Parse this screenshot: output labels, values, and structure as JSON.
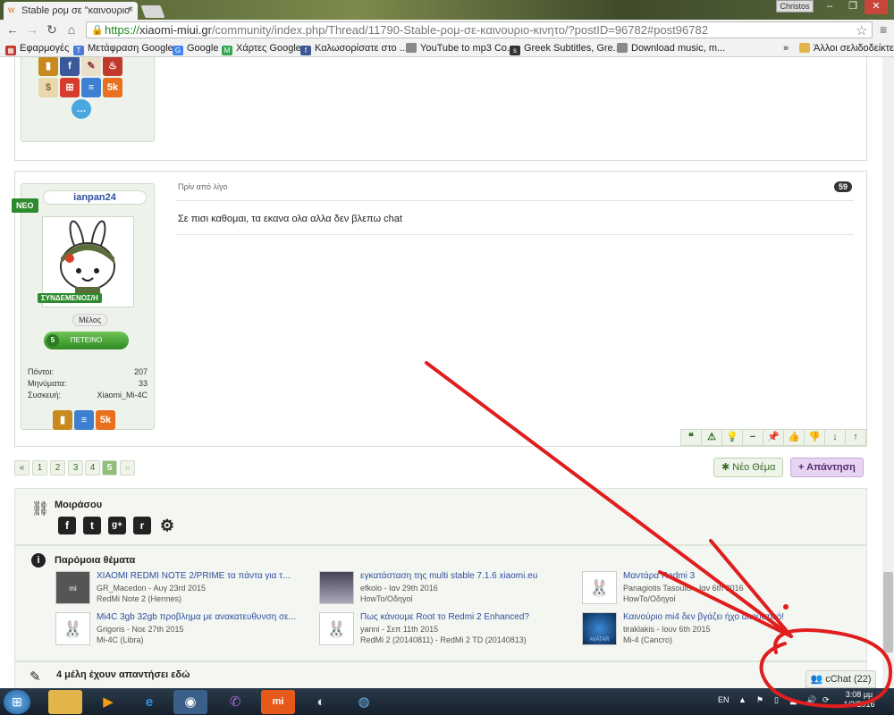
{
  "browser": {
    "tab_title": "Stable ρομ σε \"καινουριο' ",
    "tab_close": "×",
    "user_button": "Christos",
    "url_scheme": "https://",
    "url_host": "xiaomi-miui.gr",
    "url_path": "/community/index.php/Thread/11790-Stable-ρομ-σε-καινουριο-κινητο/?postID=96782#post96782",
    "bookmarks": [
      {
        "label": "Εφαρμογές",
        "icon": "apps-icon",
        "color": "#c0392b"
      },
      {
        "label": "Μετάφραση Google",
        "icon": "translate-icon",
        "color": "#4a7bd8"
      },
      {
        "label": "Google",
        "icon": "google-icon",
        "color": "#4285f4"
      },
      {
        "label": "Χάρτες Google",
        "icon": "maps-icon",
        "color": "#34a853"
      },
      {
        "label": "Καλωσορίσατε στο ...",
        "icon": "facebook-icon",
        "color": "#3b5998"
      },
      {
        "label": "YouTube to mp3 Co...",
        "icon": "page-icon",
        "color": "#888"
      },
      {
        "label": "Greek Subtitles, Gre...",
        "icon": "s4f-icon",
        "color": "#333"
      },
      {
        "label": "Download music, m...",
        "icon": "page-icon",
        "color": "#888"
      }
    ],
    "bookmarks_more": "»",
    "other_bookmarks": "Άλλοι σελιδοδείκτες"
  },
  "post": {
    "username": "ianpan24",
    "new_badge": "ΝΕΟ",
    "online_label": "ΣΥΝΔΕΜΕΝΟΣ/Η",
    "role": "Μέλος",
    "rank_label": "ΠΕΤΕΙΝΟ",
    "rank_number": "5",
    "stats": [
      {
        "label": "Πόντοι:",
        "value": "207"
      },
      {
        "label": "Μηνύματα:",
        "value": "33"
      },
      {
        "label": "Συσκευή:",
        "value": "Xiaomi_Mi-4C"
      }
    ],
    "time": "Πρίν από λίγο",
    "number": "59",
    "text": "Σε πισι καθομαι, τα εκανα ολα αλλα δεν βλεπω chat",
    "tools": [
      "❝",
      "⚠",
      "💡",
      "−",
      "📌",
      "👍",
      "👎",
      "↓",
      "↑"
    ]
  },
  "pagination": {
    "prev": "«",
    "pages": [
      "1",
      "2",
      "3",
      "4",
      "5"
    ],
    "current": "5",
    "next": "»"
  },
  "actions": {
    "new_topic": "Νέο Θέμα",
    "reply": "Απάντηση"
  },
  "share": {
    "title": "Μοιράσου",
    "networks": [
      "f",
      "t",
      "g+",
      "r",
      "⚙"
    ]
  },
  "similar": {
    "title": "Παρόμοια θέματα",
    "items": [
      {
        "title": "XIAOMI REDMI NOTE 2/PRIME τα πάντα για τ...",
        "meta": "GR_Macedon - Αυγ 23rd 2015",
        "forum": "RedMi Note 2 (Hermes)"
      },
      {
        "title": "εγκατάσταση της multi stable 7.1.6 xiaomi.eu",
        "meta": "efkolo - Ιαν 29th 2016",
        "forum": "HowTo/Οδηγοί"
      },
      {
        "title": "Μαντάρα Redmi 3",
        "meta": "Panagiotis Tasoulis - Ιαν 6th 2016",
        "forum": "HowTo/Οδηγοί"
      },
      {
        "title": "Mi4C 3gb 32gb προβλημα με ανακατευθυνση σε...",
        "meta": "Grigoris - Νοε 27th 2015",
        "forum": "Mi-4C (Libra)"
      },
      {
        "title": "Πως κάνουμε Root το Redmi 2 Enhanced?",
        "meta": "yanni - Σεπ 11th 2015",
        "forum": "RedMi 2 (20140811) - RedMi 2 TD (20140813)"
      },
      {
        "title": "Καινούριο mi4 δεν βγάζει ήχο ακουστικό!",
        "meta": "tiraklakis - Ιουν 6th 2015",
        "forum": "Mi-4 (Cancro)"
      }
    ]
  },
  "replied": {
    "title": "4 μέλη έχουν απαντήσει εδώ"
  },
  "cchat": {
    "label": "cChat (22)"
  },
  "taskbar": {
    "language": "EN",
    "time": "3:08 μμ",
    "date": "1/2/2016"
  }
}
